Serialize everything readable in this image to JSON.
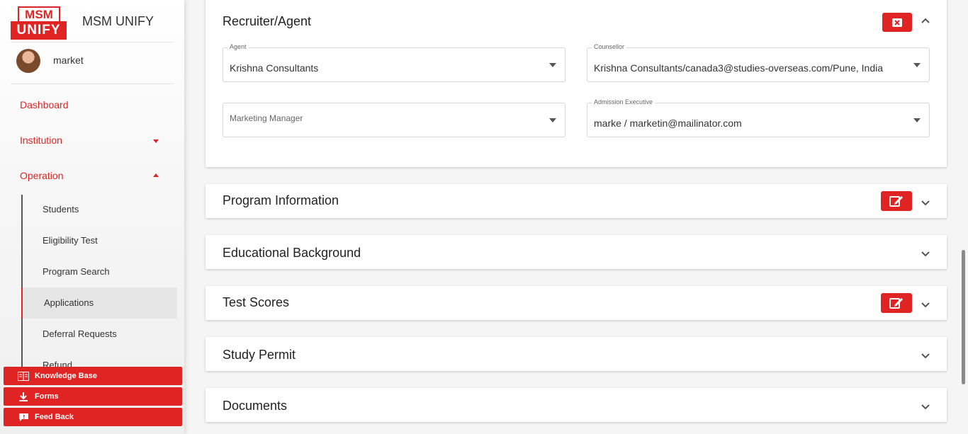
{
  "brand": {
    "logo_top": "MSM",
    "logo_bottom": "UNIFY",
    "name": "MSM UNIFY"
  },
  "user": {
    "name": "market"
  },
  "nav": {
    "dashboard": "Dashboard",
    "institution": "Institution",
    "operation": "Operation",
    "sub": [
      "Students",
      "Eligibility Test",
      "Program Search",
      "Applications",
      "Deferral Requests",
      "Refund"
    ]
  },
  "quick_links": {
    "knowledge": "Knowledge Base",
    "forms": "Forms",
    "feedback": "Feed Back"
  },
  "recruiter": {
    "title": "Recruiter/Agent",
    "agent": {
      "label": "Agent",
      "value": "Krishna Consultants"
    },
    "counsellor": {
      "label": "Counsellor",
      "value": "Krishna Consultants/canada3@studies-overseas.com/Pune, India"
    },
    "marketing": {
      "placeholder": "Marketing Manager"
    },
    "admission": {
      "label": "Admission Executive",
      "value": "marke / marketin@mailinator.com"
    }
  },
  "sections": {
    "program": "Program Information",
    "education": "Educational Background",
    "tests": "Test Scores",
    "permit": "Study Permit",
    "documents": "Documents"
  },
  "colors": {
    "accent": "#e02424"
  }
}
